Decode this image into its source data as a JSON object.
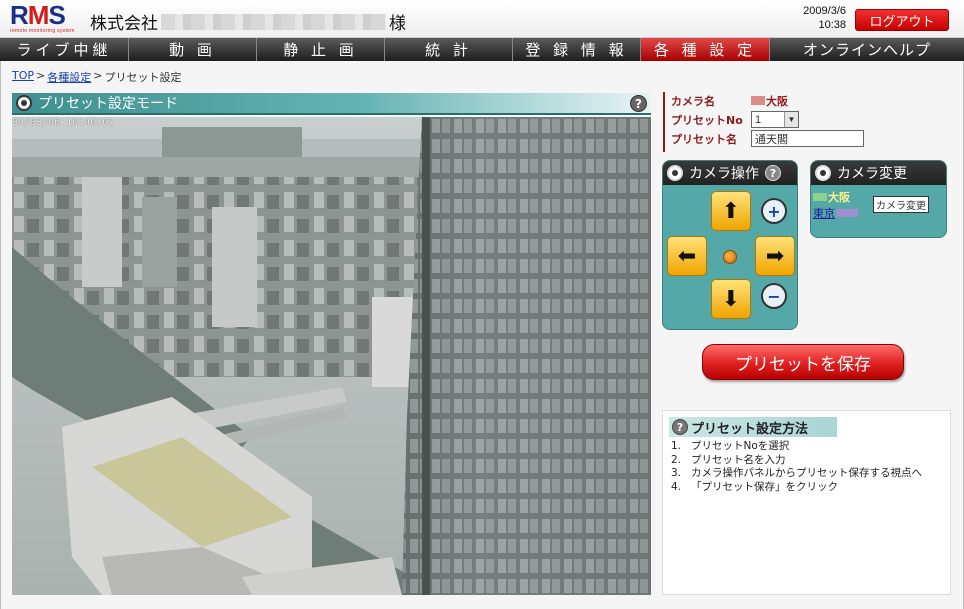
{
  "header": {
    "logo_letters": [
      "R",
      "M",
      "S"
    ],
    "logo_sub": "remote monitoring system",
    "company_prefix": "株式会社",
    "company_suffix": "様",
    "date": "2009/3/6",
    "time": "10:38",
    "logout_label": "ログアウト"
  },
  "nav": {
    "items": [
      {
        "label": "ライブ中継"
      },
      {
        "label": "動 画"
      },
      {
        "label": "静 止 画"
      },
      {
        "label": "統 計"
      },
      {
        "label": "登 録 情 報"
      },
      {
        "label": "各 種 設 定"
      },
      {
        "label": "オンラインヘルプ"
      }
    ]
  },
  "breadcrumb": {
    "top": "TOP",
    "sep": ">",
    "settings": "各種設定",
    "current": "プリセット設定"
  },
  "camera": {
    "title": "プリセット設定モード",
    "help": "?",
    "timestamp": "09/03/06 10:40:07"
  },
  "settings": {
    "camera_label": "カメラ名",
    "camera_value": "大阪",
    "preset_no_label": "プリセットNo",
    "preset_no_value": "1",
    "preset_name_label": "プリセット名",
    "preset_name_value": "通天閣"
  },
  "camera_op": {
    "title": "カメラ操作",
    "help": "?",
    "up": "⬆",
    "down": "⬇",
    "left": "⬅",
    "right": "➡",
    "zoom_in": "+",
    "zoom_out": "−"
  },
  "camera_change": {
    "title": "カメラ変更",
    "current": "大阪",
    "other": "東京",
    "button": "カメラ変更"
  },
  "save_button": "プリセットを保存",
  "howto": {
    "title": "プリセット設定方法",
    "q": "?",
    "steps": [
      {
        "num": "1.",
        "text": "プリセットNoを選択"
      },
      {
        "num": "2.",
        "text": "プリセット名を入力"
      },
      {
        "num": "3.",
        "text": "カメラ操作パネルからプリセット保存する視点へ"
      },
      {
        "num": "4.",
        "text": "「プリセット保存」をクリック"
      }
    ]
  }
}
